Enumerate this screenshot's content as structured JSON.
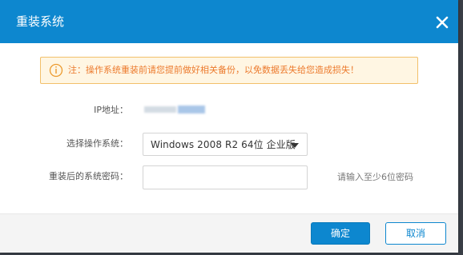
{
  "dialog": {
    "title": "重装系统",
    "close_icon": "close-icon"
  },
  "notice": {
    "icon": "info-circle-icon",
    "text": "注：操作系统重装前请您提前做好相关备份，以免数据丢失给您造成损失！"
  },
  "form": {
    "ip_label": "IP地址：",
    "os_label": "选择操作系统：",
    "os_selected": "Windows 2008 R2 64位 企业版",
    "password_label": "重装后的系统密码：",
    "password_value": "",
    "password_hint": "请输入至少6位密码"
  },
  "footer": {
    "ok_label": "确定",
    "cancel_label": "取消"
  },
  "colors": {
    "accent": "#0d87cf",
    "notice_bg": "#fff6e3",
    "notice_border": "#f2c06a",
    "notice_text": "#ec7a2d"
  }
}
